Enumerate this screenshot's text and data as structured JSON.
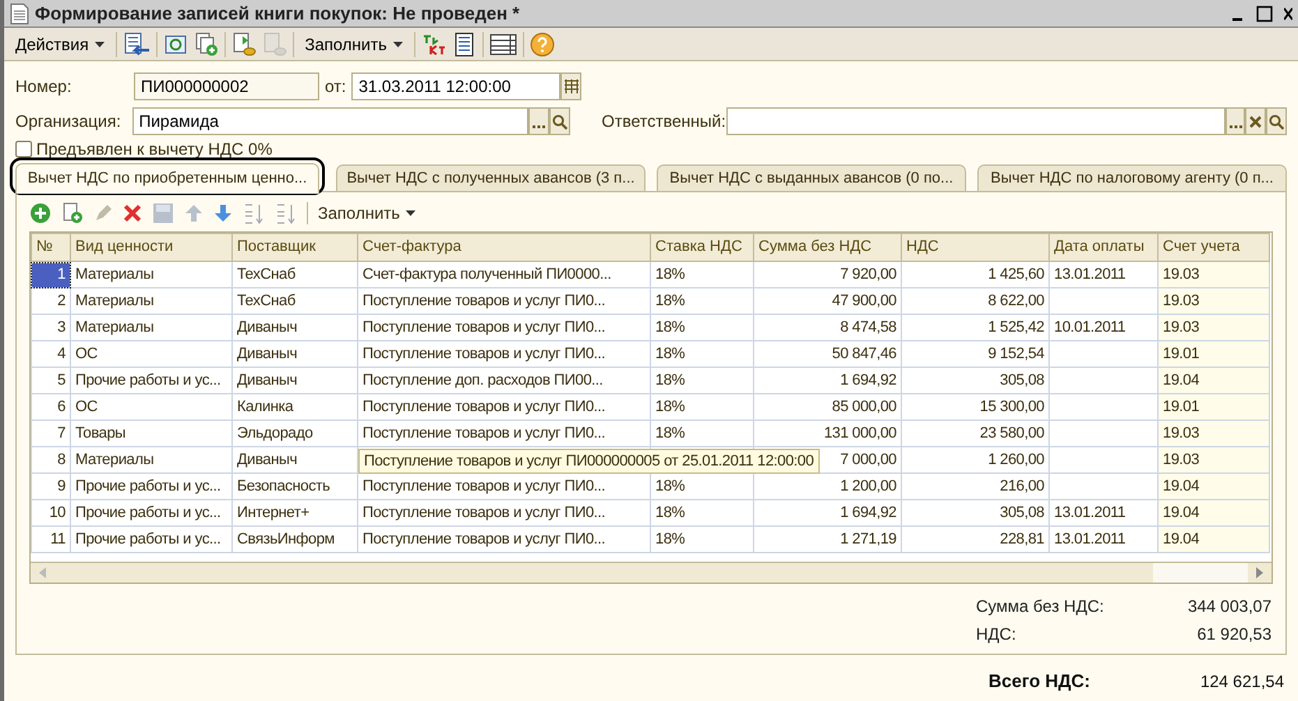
{
  "window": {
    "title": "Формирование записей книги покупок: Не проведен *"
  },
  "toolbar": {
    "actions_menu": "Действия",
    "fill_menu": "Заполнить"
  },
  "form": {
    "number_label": "Номер:",
    "number": "ПИ000000002",
    "date_label": "от:",
    "date": "31.03.2011 12:00:00",
    "organization_label": "Организация:",
    "organization": "Пирамида",
    "responsible_label": "Ответственный:"
  },
  "checkbox": {
    "label": "Предъявлен к вычету НДС 0%",
    "checked": false
  },
  "tabs": [
    {
      "label": "Вычет НДС по приобретенным ценно...",
      "selected": true,
      "highlighted": true
    },
    {
      "label": "Вычет НДС с полученных авансов (3 п...",
      "selected": false,
      "highlighted": false
    },
    {
      "label": "Вычет НДС с выданных авансов (0 по...",
      "selected": false,
      "highlighted": false
    },
    {
      "label": "Вычет НДС по налоговому агенту (0 п...",
      "selected": false,
      "highlighted": false
    }
  ],
  "table_toolbar": {
    "fill_menu": "Заполнить"
  },
  "table": {
    "columns": [
      "№",
      "Вид ценности",
      "Поставщик",
      "Счет-фактура",
      "Ставка НДС",
      "Сумма без НДС",
      "НДС",
      "Дата оплаты",
      "Счет учета"
    ],
    "rows": [
      {
        "no": "1",
        "type": "Материалы",
        "supplier": "ТехСнаб",
        "invoice": "Счет-фактура полученный ПИ0000...",
        "rate": "18%",
        "amount": "7 920,00",
        "vat": "1 425,60",
        "paid": "13.01.2011",
        "account": "19.03",
        "selected": true
      },
      {
        "no": "2",
        "type": "Материалы",
        "supplier": "ТехСнаб",
        "invoice": "Поступление товаров и услуг ПИ0...",
        "rate": "18%",
        "amount": "47 900,00",
        "vat": "8 622,00",
        "account": "19.03",
        "selected": false
      },
      {
        "no": "3",
        "type": "Материалы",
        "supplier": "Диваныч",
        "invoice": "Поступление товаров и услуг ПИ0...",
        "rate": "18%",
        "amount": "8 474,58",
        "vat": "1 525,42",
        "paid": "10.01.2011",
        "account": "19.03",
        "selected": false
      },
      {
        "no": "4",
        "type": "ОС",
        "supplier": "Диваныч",
        "invoice": "Поступление товаров и услуг ПИ0...",
        "rate": "18%",
        "amount": "50 847,46",
        "vat": "9 152,54",
        "account": "19.01",
        "selected": false
      },
      {
        "no": "5",
        "type": "Прочие работы и ус...",
        "supplier": "Диваныч",
        "invoice": "Поступление доп. расходов ПИ00...",
        "rate": "18%",
        "amount": "1 694,92",
        "vat": "305,08",
        "account": "19.04",
        "selected": false
      },
      {
        "no": "6",
        "type": "ОС",
        "supplier": "Калинка",
        "invoice": "Поступление товаров и услуг ПИ0...",
        "rate": "18%",
        "amount": "85 000,00",
        "vat": "15 300,00",
        "account": "19.01",
        "selected": false
      },
      {
        "no": "7",
        "type": "Товары",
        "supplier": "Эльдорадо",
        "invoice": "Поступление товаров и услуг ПИ0...",
        "rate": "18%",
        "amount": "131 000,00",
        "vat": "23 580,00",
        "account": "19.03",
        "selected": false
      },
      {
        "no": "8",
        "type": "Материалы",
        "supplier": "Диваныч",
        "tooltip": "Поступление товаров и услуг ПИ000000005 от 25.01.2011 12:00:00",
        "amount": "7 000,00",
        "vat": "1 260,00",
        "account": "19.03",
        "selected": false
      },
      {
        "no": "9",
        "type": "Прочие работы и ус...",
        "supplier": "Безопасность",
        "invoice": "Поступление товаров и услуг ПИ0...",
        "rate": "18%",
        "amount": "1 200,00",
        "vat": "216,00",
        "account": "19.04",
        "selected": false
      },
      {
        "no": "10",
        "type": "Прочие работы и ус...",
        "supplier": "Интернет+",
        "invoice": "Поступление товаров и услуг ПИ0...",
        "rate": "18%",
        "amount": "1 694,92",
        "vat": "305,08",
        "paid": "13.01.2011",
        "account": "19.04",
        "selected": false
      },
      {
        "no": "11",
        "type": "Прочие работы и ус...",
        "supplier": "СвязьИнформ",
        "invoice": "Поступление товаров и услуг ПИ0...",
        "rate": "18%",
        "amount": "1 271,19",
        "vat": "228,81",
        "paid": "13.01.2011",
        "account": "19.04",
        "selected": false
      }
    ]
  },
  "totals": [
    {
      "label": "Сумма без НДС:",
      "value": "344 003,07"
    },
    {
      "label": "НДС:",
      "value": "61 920,53"
    }
  ],
  "grand_total": {
    "label": "Всего НДС:",
    "value": "124 621,54"
  }
}
